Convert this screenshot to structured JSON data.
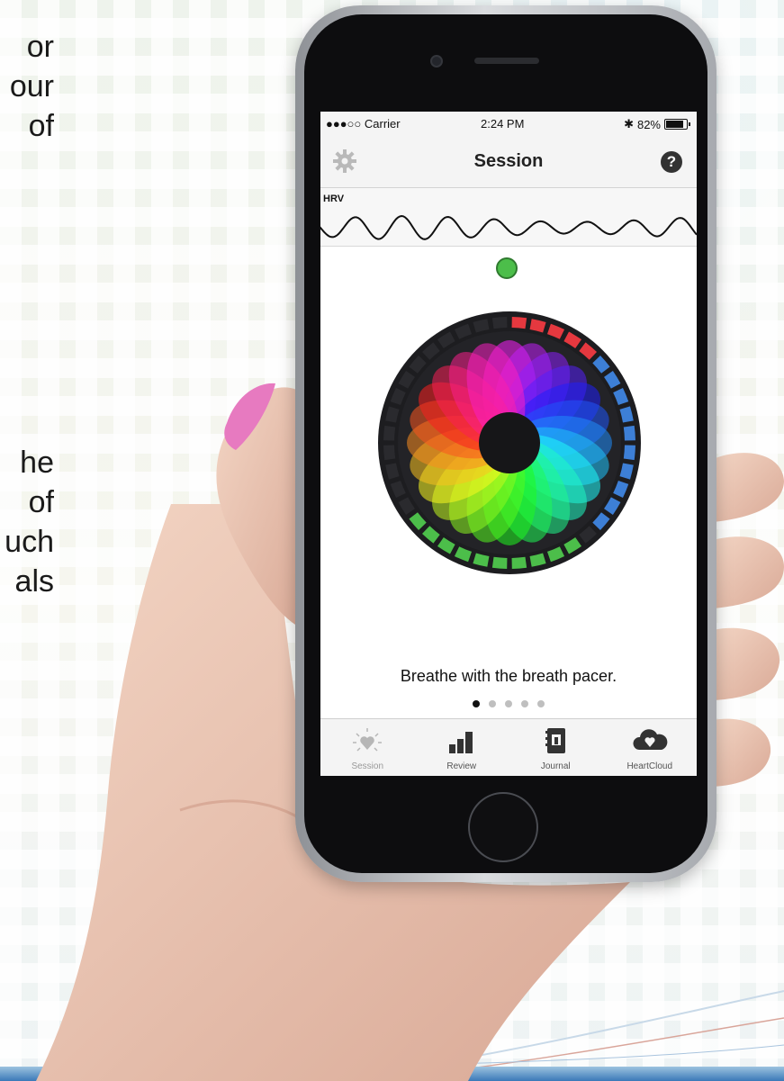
{
  "background": {
    "text_fragments": [
      "or",
      "our",
      "of",
      "he",
      "of",
      "uch",
      "als"
    ]
  },
  "status_bar": {
    "signal": "●●●○○ Carrier",
    "time": "2:24 PM",
    "bluetooth": "✱",
    "battery": "82%"
  },
  "nav": {
    "title": "Session",
    "help": "?"
  },
  "hrv": {
    "label": "HRV"
  },
  "coherence_indicator_color": "#4cbe4a",
  "instruction": "Breathe with the breath pacer.",
  "pager": {
    "count": 5,
    "active_index": 0
  },
  "tabs": [
    {
      "label": "Session",
      "icon": "heart-sparkle-icon"
    },
    {
      "label": "Review",
      "icon": "bar-chart-icon"
    },
    {
      "label": "Journal",
      "icon": "journal-icon"
    },
    {
      "label": "HeartCloud",
      "icon": "cloud-heart-icon"
    }
  ],
  "colors": {
    "accent_green": "#4cbe4a",
    "ring_red": "#e5383f",
    "ring_blue": "#3d7fd6",
    "ring_dark": "#2a2a2e"
  }
}
